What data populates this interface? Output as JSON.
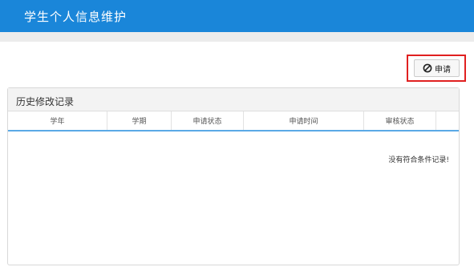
{
  "header": {
    "title": "学生个人信息维护"
  },
  "toolbar": {
    "apply_label": "申请",
    "apply_icon": "ban-icon"
  },
  "history_panel": {
    "title": "历史修改记录",
    "columns": [
      "学年",
      "学期",
      "申请状态",
      "申请时间",
      "审核状态"
    ],
    "empty_message": "没有符合条件记录!"
  },
  "colors": {
    "header_bg": "#1a86d9",
    "highlight_border": "#e02020",
    "table_accent": "#5aa9e6"
  }
}
